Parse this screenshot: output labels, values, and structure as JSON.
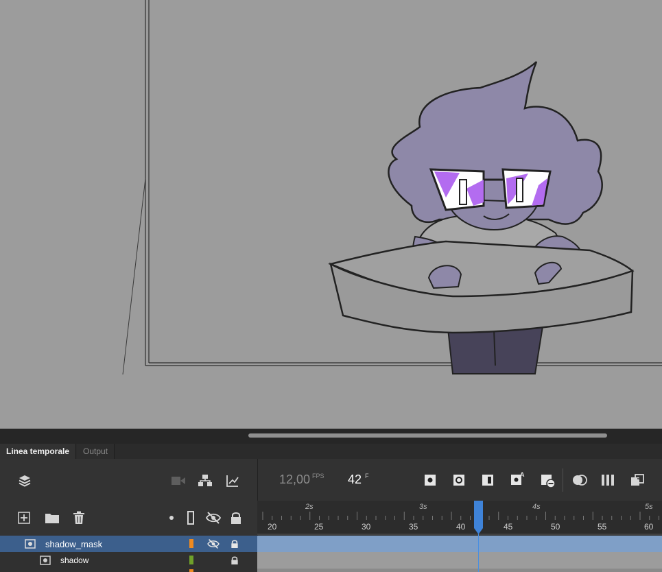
{
  "tabs": {
    "timeline": "Linea temporale",
    "output": "Output"
  },
  "controls": {
    "fps_value": "12,00",
    "fps_unit": "FPS",
    "frame_value": "42",
    "frame_unit": "F"
  },
  "ruler": {
    "seconds": [
      "2s",
      "3s",
      "4s",
      "5s"
    ],
    "frames": [
      "20",
      "25",
      "30",
      "35",
      "40",
      "45",
      "50",
      "55",
      "60"
    ]
  },
  "layers": [
    {
      "name": "shadow_mask",
      "selected": true,
      "color": "#ef8a1f"
    },
    {
      "name": "shadow",
      "selected": false,
      "color": "#6fa12a"
    }
  ],
  "icons": {
    "layers": "layers-icon",
    "camera": "camera-icon",
    "parenting": "parenting-icon",
    "graph": "graph-icon",
    "add_layer": "add-layer-icon",
    "folder": "folder-icon",
    "trash": "trash-icon",
    "eye_hidden": "eye-hidden-icon",
    "lock": "lock-icon"
  },
  "colors": {
    "stage": "#9c9c9c",
    "selection": "#3c5f8c",
    "playhead": "#4a8fe0",
    "track_selected": "#7f9fc7"
  }
}
